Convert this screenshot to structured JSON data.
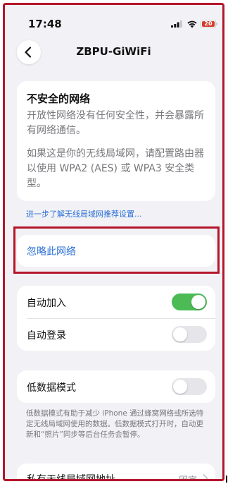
{
  "status_bar": {
    "time": "17:48",
    "battery_level": "20"
  },
  "nav": {
    "back_icon": "chevron-left-icon",
    "title": "ZBPU-GiWiFi"
  },
  "warning": {
    "title": "不安全的网络",
    "body1": "开放性网络没有任何安全性，并会暴露所有网络通信。",
    "body2": "如果这是你的无线局域网，请配置路由器以使用 WPA2 (AES) 或 WPA3 安全类型。"
  },
  "learn_more_link": "进一步了解无线局域网推荐设置...",
  "forget_network": "忽略此网络",
  "settings": {
    "auto_join": {
      "label": "自动加入",
      "on": true
    },
    "auto_login": {
      "label": "自动登录",
      "on": false
    }
  },
  "low_data": {
    "label": "低数据模式",
    "on": false,
    "note": "低数据模式有助于减少 iPhone 通过蜂窝网络或所选特定无线局域网使用的数据。低数据模式打开时，自动更新和“照片”同步等后台任务会暂停。"
  },
  "private_address": {
    "label": "私有无线局域网地址",
    "value": "固定"
  },
  "colors": {
    "accent": "#2b6fd6",
    "switch_on": "#4cbb56",
    "highlight_border": "#b5152b"
  }
}
